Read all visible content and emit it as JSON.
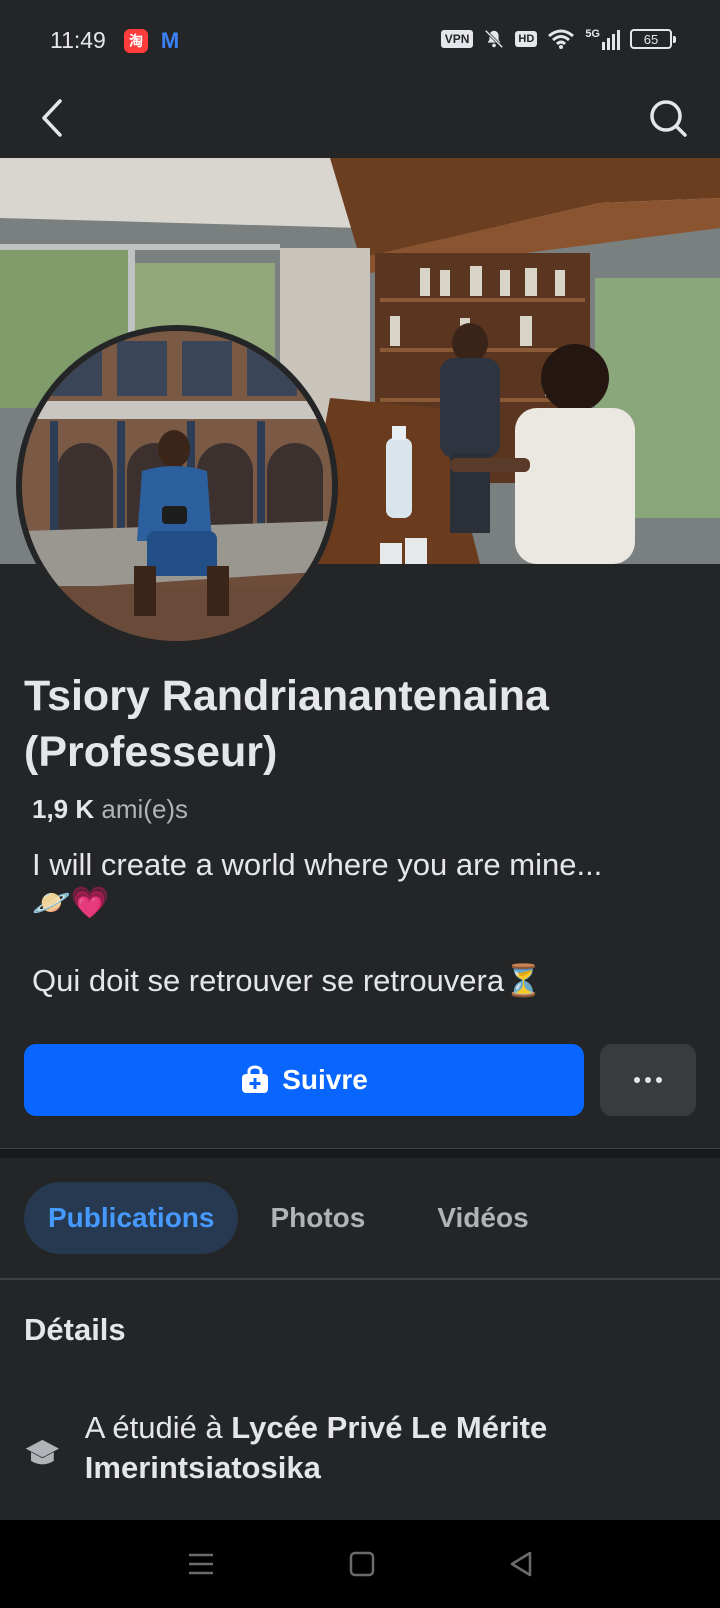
{
  "status_bar": {
    "time": "11:49",
    "vpn": "VPN",
    "hd": "HD",
    "network": "5G",
    "battery": "65"
  },
  "profile": {
    "name": "Tsiory Randrianantenaina (Professeur)",
    "friends_count": "1,9 K",
    "friends_label": "ami(e)s",
    "bio_line1": "I will create a world where you are mine...",
    "bio_line2": "🪐💗",
    "bio_line3": "Qui doit se retrouver se retrouvera⏳"
  },
  "actions": {
    "follow_label": "Suivre"
  },
  "tabs": [
    {
      "label": "Publications",
      "active": true
    },
    {
      "label": "Photos",
      "active": false
    },
    {
      "label": "Vidéos",
      "active": false
    }
  ],
  "details": {
    "title": "Détails",
    "education_prefix": "A étudié à ",
    "education_school": "Lycée Privé Le Mérite Imerintsiatosika"
  },
  "colors": {
    "background": "#242526",
    "primary": "#0866ff",
    "active_tab_bg": "#263951",
    "active_tab_text": "#4599ff"
  }
}
